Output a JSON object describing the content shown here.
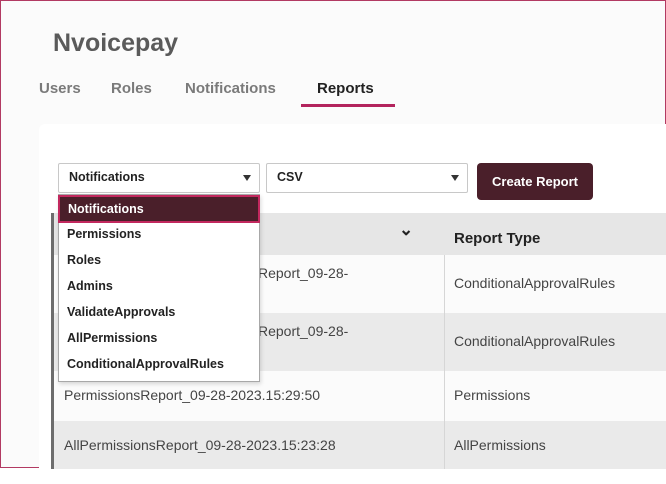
{
  "app": {
    "title": "Nvoicepay"
  },
  "tabs": [
    {
      "label": "Users",
      "active": false
    },
    {
      "label": "Roles",
      "active": false
    },
    {
      "label": "Notifications",
      "active": false
    },
    {
      "label": "Reports",
      "active": true
    }
  ],
  "controls": {
    "report_select_value": "Notifications",
    "format_select_value": "CSV",
    "create_button_label": "Create Report"
  },
  "dropdown": {
    "options": [
      "Notifications",
      "Permissions",
      "Roles",
      "Admins",
      "ValidateApprovals",
      "AllPermissions",
      "ConditionalApprovalRules"
    ],
    "selected": "Notifications"
  },
  "table": {
    "columns": [
      "",
      "Report Type"
    ],
    "rows": [
      {
        "name": "Report_09-28-",
        "type": "ConditionalApprovalRules"
      },
      {
        "name": "Report_09-28-",
        "type": "ConditionalApprovalRules"
      },
      {
        "name": "PermissionsReport_09-28-2023.15:29:50",
        "type": "Permissions"
      },
      {
        "name": "AllPermissionsReport_09-28-2023.15:23:28",
        "type": "AllPermissions"
      }
    ]
  },
  "colors": {
    "accent": "#b3245d",
    "button_bg": "#4a1f2a",
    "header_bg": "#e6e6e6"
  },
  "icons": {
    "select_arrow": "caret-down-icon",
    "sort": "chevron-down-icon"
  }
}
